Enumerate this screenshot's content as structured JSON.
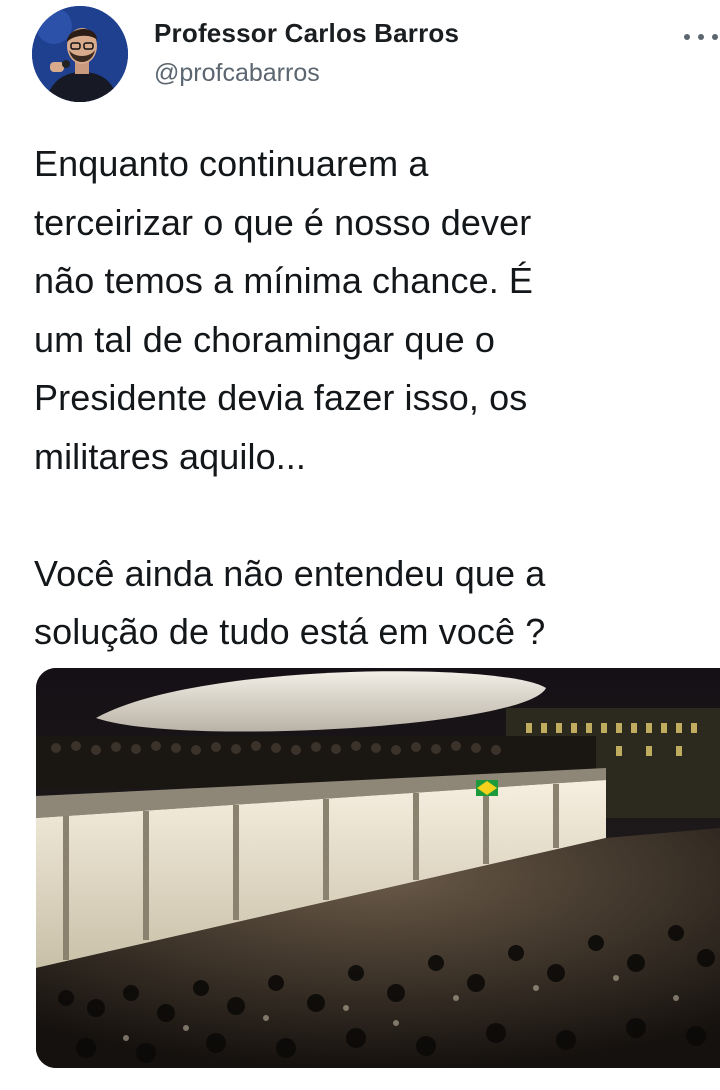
{
  "author": {
    "display_name": "Professor Carlos Barros",
    "handle": "@profcabarros"
  },
  "tweet": {
    "text": "Enquanto continuarem a\nterceirizar o que é nosso dever\nnão temos a mínima chance. É\num tal de choramingar que o\nPresidente devia fazer isso, os\nmilitares aquilo...\n\nVocê ainda não entendeu que a\nsolução de tudo está em você ?"
  },
  "icons": {
    "more": "more-options-icon",
    "avatar": "profile-photo"
  },
  "colors": {
    "avatar_bg": "#1f3f8f",
    "text": "#14171a",
    "handle": "#5b6670"
  }
}
